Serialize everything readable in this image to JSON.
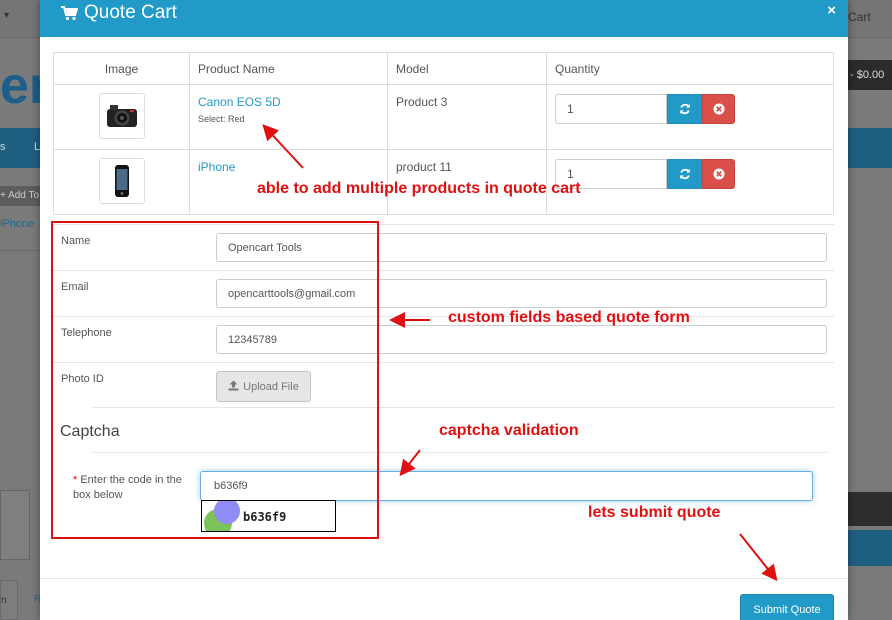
{
  "background": {
    "cart_link": "Cart",
    "chevron": "▾",
    "logo_letters": "er",
    "cart_total": "- $0.00",
    "menu_item_1": "s",
    "menu_item_2": "L",
    "alert_text": "+ Add To",
    "breadcrumb": "iPhone",
    "tab_1": "n",
    "tab_2": "R"
  },
  "modal": {
    "title": "Quote Cart",
    "close_symbol": "×"
  },
  "table": {
    "headers": [
      "Image",
      "Product Name",
      "Model",
      "Quantity"
    ],
    "rows": [
      {
        "name": "Canon EOS 5D",
        "option": "Select: Red",
        "model": "Product 3",
        "quantity": "1",
        "thumb": "camera-icon"
      },
      {
        "name": "iPhone",
        "option": "",
        "model": "product 11",
        "quantity": "1",
        "thumb": "phone-icon"
      }
    ]
  },
  "form": {
    "name_label": "Name",
    "name_value": "Opencart Tools",
    "email_label": "Email",
    "email_value": "opencarttools@gmail.com",
    "telephone_label": "Telephone",
    "telephone_value": "12345789",
    "photo_label": "Photo ID",
    "upload_label": "Upload File",
    "captcha_heading": "Captcha",
    "captcha_required": "*",
    "captcha_label": "Enter the code in the box below",
    "captcha_value": "b636f9",
    "captcha_image_code": "b636f9",
    "submit_label": "Submit Quote"
  },
  "annotations": {
    "multiple_products": "able to add multiple products in quote cart",
    "custom_fields": "custom fields based quote form",
    "captcha": "captcha validation",
    "submit": "lets submit quote"
  },
  "colors": {
    "primary": "#229ac8",
    "danger": "#da4f49",
    "annotation": "#e01010"
  }
}
